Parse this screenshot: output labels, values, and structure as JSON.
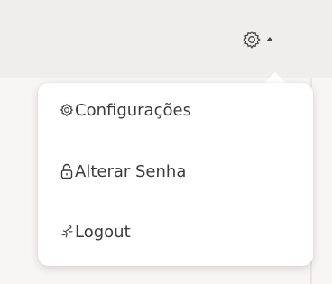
{
  "header": {
    "settings_icon": "gear-icon",
    "caret_icon": "caret-up-icon"
  },
  "menu": {
    "items": [
      {
        "label": "Configurações",
        "icon": "gear-icon"
      },
      {
        "label": "Alterar Senha",
        "icon": "lock-icon"
      },
      {
        "label": "Logout",
        "icon": "running-icon"
      }
    ]
  },
  "colors": {
    "text": "#3c3c3c",
    "menu_background": "#ffffff",
    "header_background": "#f0eeed",
    "page_background": "#f7f5f4"
  }
}
